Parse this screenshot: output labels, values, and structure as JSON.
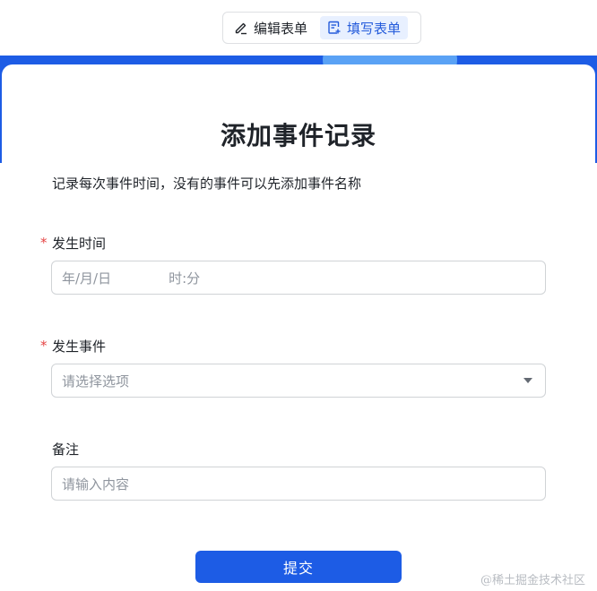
{
  "toolbar": {
    "edit_label": "编辑表单",
    "fill_label": "填写表单",
    "active": "fill"
  },
  "form": {
    "title": "添加事件记录",
    "description": "记录每次事件时间，没有的事件可以先添加事件名称",
    "fields": [
      {
        "label": "发生时间",
        "required": true,
        "type": "datetime",
        "date_placeholder": "年/月/日",
        "time_placeholder": "时:分"
      },
      {
        "label": "发生事件",
        "required": true,
        "type": "select",
        "placeholder": "请选择选项"
      },
      {
        "label": "备注",
        "required": false,
        "type": "text",
        "placeholder": "请输入内容"
      }
    ],
    "required_mark": "*",
    "submit_label": "提交"
  },
  "watermark": "@稀土掘金技术社区",
  "colors": {
    "primary": "#1d5ce5",
    "banner_accent": "#5aa2f5",
    "required": "#e54545",
    "active_tab_bg": "#e8f0ff"
  },
  "icons": {
    "edit": "pencil-icon",
    "fill": "form-fill-icon",
    "select": "chevron-down-icon"
  }
}
